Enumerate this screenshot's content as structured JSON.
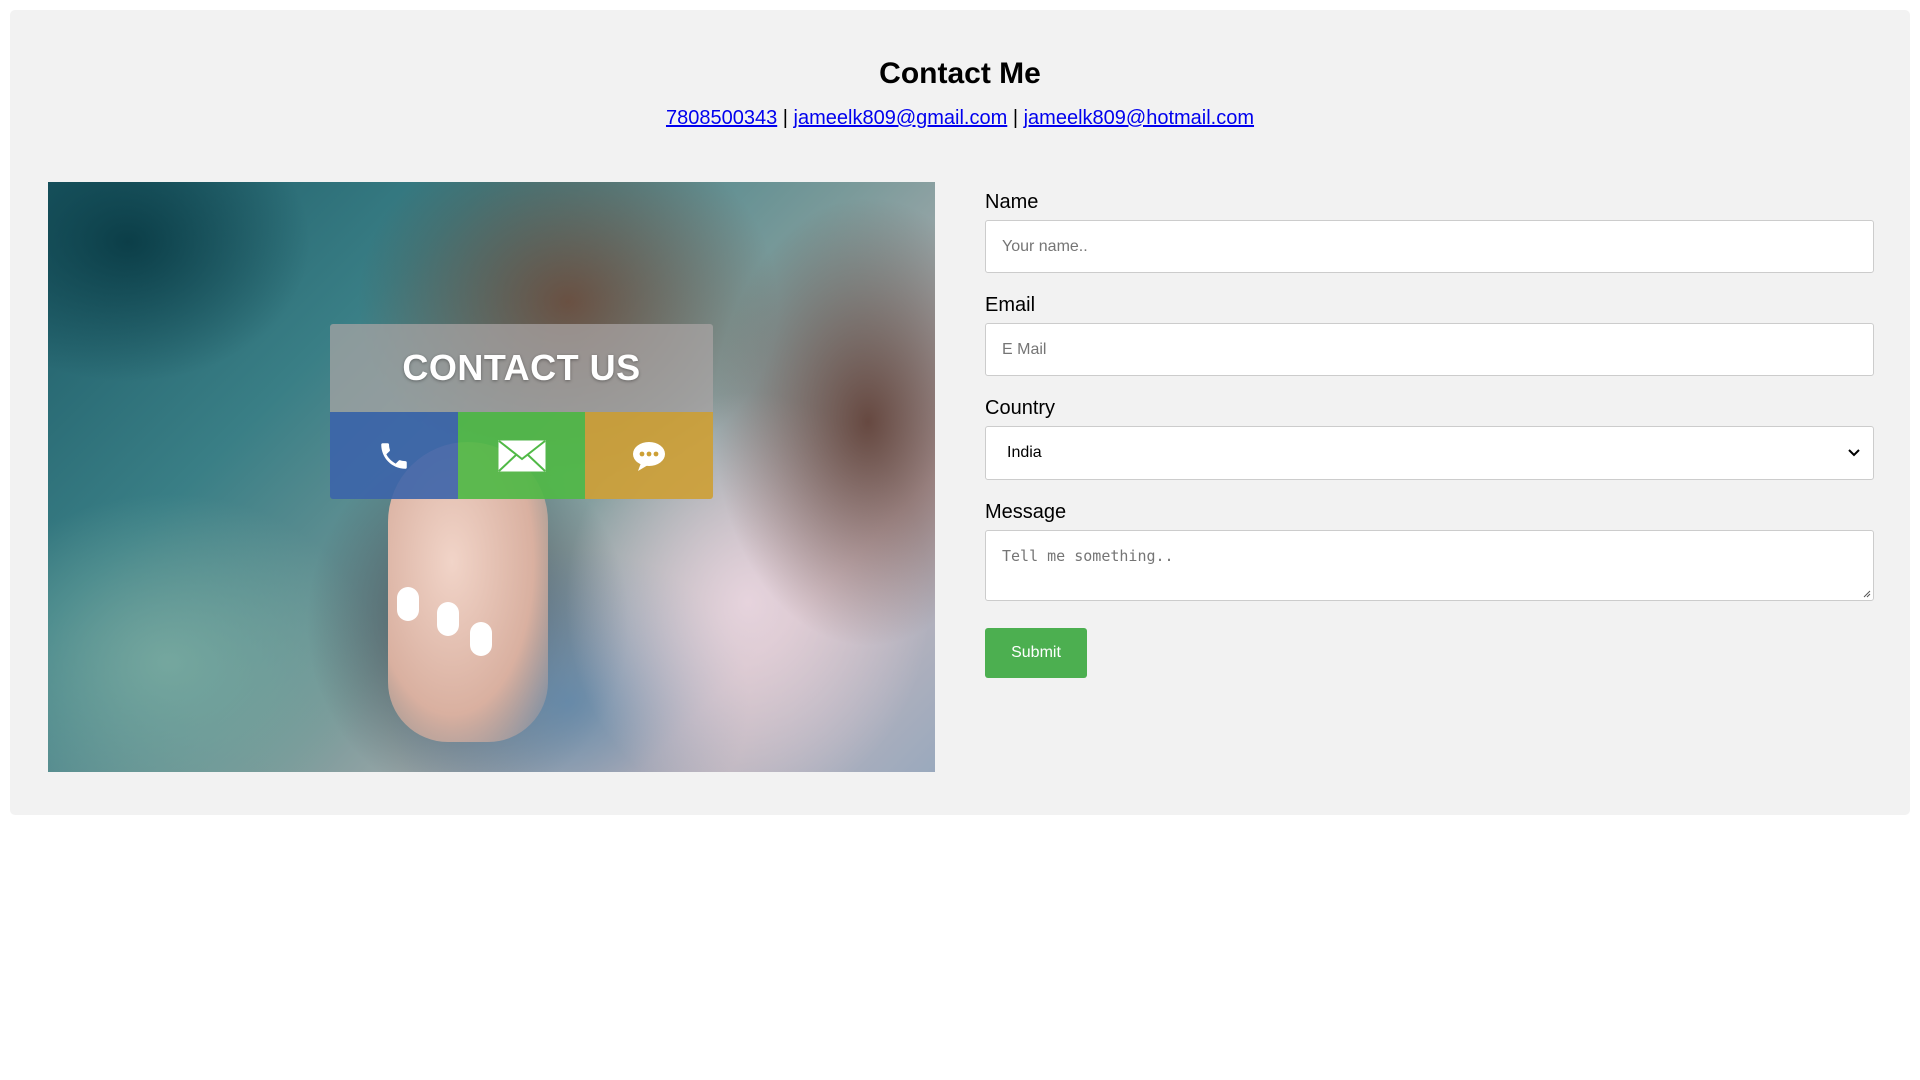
{
  "header": {
    "title": "Contact Me",
    "phone": "7808500343",
    "separator": "|",
    "email_gmail": "jameelk809@gmail.com",
    "email_hotmail": "jameelk809@hotmail.com"
  },
  "hero": {
    "banner_text": "CONTACT US",
    "icons": [
      "phone-icon",
      "envelope-icon",
      "chat-icon"
    ],
    "tile_colors": [
      "#3c64aa",
      "#50b946",
      "#cda037"
    ]
  },
  "form": {
    "name_label": "Name",
    "name_placeholder": "Your name..",
    "email_label": "Email",
    "email_placeholder": "E Mail",
    "country_label": "Country",
    "country_selected": "India",
    "message_label": "Message",
    "message_placeholder": "Tell me something..",
    "submit_label": "Submit"
  },
  "colors": {
    "panel_bg": "#f2f2f2",
    "link": "#0000ee",
    "submit_bg": "#4caf50"
  }
}
